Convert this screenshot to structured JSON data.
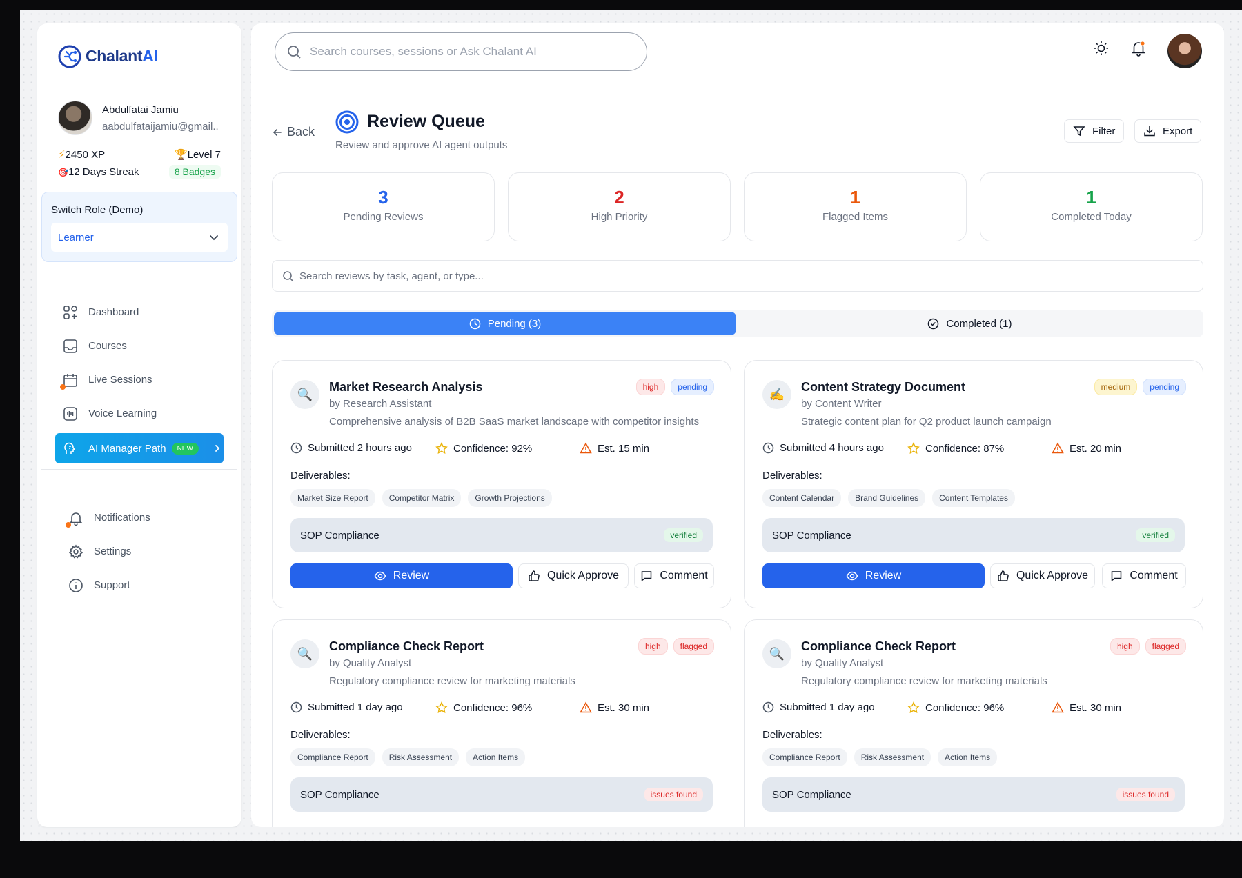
{
  "app": {
    "brand_main": "Chalant",
    "brand_accent": "AI"
  },
  "user": {
    "name": "Abdulfatai Jamiu",
    "email": "aabdulfataijamiu@gmail..",
    "xp": "2450 XP",
    "level": "Level 7",
    "streak": "12 Days Streak",
    "badges": "8 Badges"
  },
  "role": {
    "label": "Switch Role (Demo)",
    "value": "Learner"
  },
  "nav": {
    "dashboard": "Dashboard",
    "courses": "Courses",
    "live_sessions": "Live Sessions",
    "voice_learning": "Voice Learning",
    "ai_manager": "AI Manager Path",
    "new_badge": "NEW",
    "notifications": "Notifications",
    "settings": "Settings",
    "support": "Support"
  },
  "header": {
    "search_placeholder": "Search courses, sessions or Ask Chalant AI"
  },
  "page": {
    "back": "Back",
    "title": "Review Queue",
    "subtitle": "Review and approve AI agent outputs",
    "filter": "Filter",
    "export": "Export",
    "search_placeholder": "Search reviews by task, agent, or type..."
  },
  "stats": [
    {
      "value": "3",
      "label": "Pending Reviews",
      "color": "#2563eb"
    },
    {
      "value": "2",
      "label": "High Priority",
      "color": "#dc2626"
    },
    {
      "value": "1",
      "label": "Flagged Items",
      "color": "#ea580c"
    },
    {
      "value": "1",
      "label": "Completed Today",
      "color": "#16a34a"
    }
  ],
  "tabs": {
    "pending": "Pending (3)",
    "completed": "Completed (1)"
  },
  "reviews": [
    {
      "icon": "🔍",
      "title": "Market Research Analysis",
      "by": "by Research Assistant",
      "desc": "Comprehensive analysis of B2B SaaS market landscape with competitor insights",
      "priority": "high",
      "status": "pending",
      "submitted": "Submitted 2 hours ago",
      "confidence": "Confidence: 92%",
      "est": "Est. 15 min",
      "deliverables_label": "Deliverables:",
      "deliverables": [
        "Market Size Report",
        "Competitor Matrix",
        "Growth Projections"
      ],
      "sop": "SOP Compliance",
      "sop_status": "verified",
      "review": "Review",
      "approve": "Quick Approve",
      "comment": "Comment"
    },
    {
      "icon": "✍️",
      "title": "Content Strategy Document",
      "by": "by Content Writer",
      "desc": "Strategic content plan for Q2 product launch campaign",
      "priority": "medium",
      "status": "pending",
      "submitted": "Submitted 4 hours ago",
      "confidence": "Confidence: 87%",
      "est": "Est. 20 min",
      "deliverables_label": "Deliverables:",
      "deliverables": [
        "Content Calendar",
        "Brand Guidelines",
        "Content Templates"
      ],
      "sop": "SOP Compliance",
      "sop_status": "verified",
      "review": "Review",
      "approve": "Quick Approve",
      "comment": "Comment"
    },
    {
      "icon": "🔍",
      "title": "Compliance Check Report",
      "by": "by Quality Analyst",
      "desc": "Regulatory compliance review for marketing materials",
      "priority": "high",
      "status": "flagged",
      "submitted": "Submitted 1 day ago",
      "confidence": "Confidence: 96%",
      "est": "Est. 30 min",
      "deliverables_label": "Deliverables:",
      "deliverables": [
        "Compliance Report",
        "Risk Assessment",
        "Action Items"
      ],
      "sop": "SOP Compliance",
      "sop_status": "issues found"
    },
    {
      "icon": "🔍",
      "title": "Compliance Check Report",
      "by": "by Quality Analyst",
      "desc": "Regulatory compliance review for marketing materials",
      "priority": "high",
      "status": "flagged",
      "submitted": "Submitted 1 day ago",
      "confidence": "Confidence: 96%",
      "est": "Est. 30 min",
      "deliverables_label": "Deliverables:",
      "deliverables": [
        "Compliance Report",
        "Risk Assessment",
        "Action Items"
      ],
      "sop": "SOP Compliance",
      "sop_status": "issues found"
    }
  ]
}
